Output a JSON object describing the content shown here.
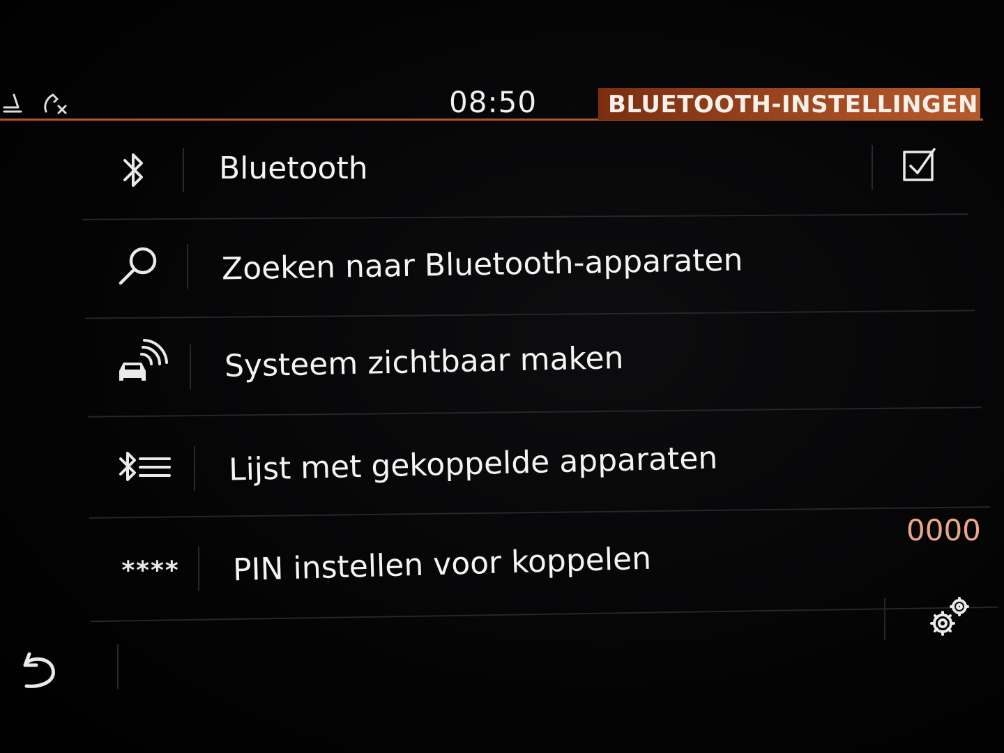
{
  "header": {
    "clock": "08:50",
    "title": "BLUETOOTH-INSTELLINGEN",
    "accent_color": "#b4562a",
    "status_icons": [
      "seat-icon",
      "phone-missed-icon"
    ]
  },
  "menu": {
    "items": [
      {
        "icon": "bluetooth-icon",
        "label": "Bluetooth",
        "control": "checkbox",
        "checked": true
      },
      {
        "icon": "search-icon",
        "label": "Zoeken naar Bluetooth-apparaten"
      },
      {
        "icon": "car-broadcast-icon",
        "label": "Systeem zichtbaar maken"
      },
      {
        "icon": "bluetooth-list-icon",
        "label": "Lijst met gekoppelde apparaten"
      },
      {
        "icon": "pin-icon",
        "icon_text": "****",
        "label": "PIN instellen voor koppelen",
        "value": "0000"
      }
    ]
  },
  "footer": {
    "left_icon": "back-icon",
    "right_icon": "settings-gears-icon"
  }
}
